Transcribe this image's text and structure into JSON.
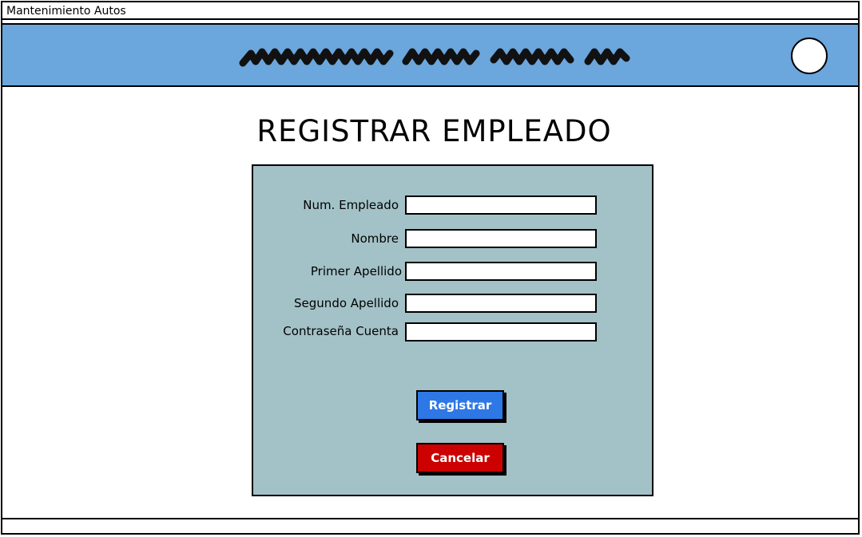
{
  "window": {
    "title": "Mantenimiento Autos"
  },
  "header": {
    "logo_icon": "scribble-placeholder-text",
    "avatar_icon": "user-avatar-circle",
    "color": "#6ba6dd"
  },
  "page": {
    "title": "REGISTRAR EMPLEADO"
  },
  "form": {
    "background": "#a3c2c7",
    "fields": [
      {
        "label": "Num. Empleado",
        "value": "",
        "placeholder": ""
      },
      {
        "label": "Nombre",
        "value": "",
        "placeholder": ""
      },
      {
        "label": "Primer Apellido",
        "value": "",
        "placeholder": ""
      },
      {
        "label": "Segundo Apellido",
        "value": "",
        "placeholder": ""
      },
      {
        "label": "Contraseña Cuenta",
        "value": "",
        "placeholder": ""
      }
    ],
    "register_label": "Registrar",
    "cancel_label": "Cancelar",
    "register_color": "#2e78e6",
    "cancel_color": "#cc0000"
  }
}
